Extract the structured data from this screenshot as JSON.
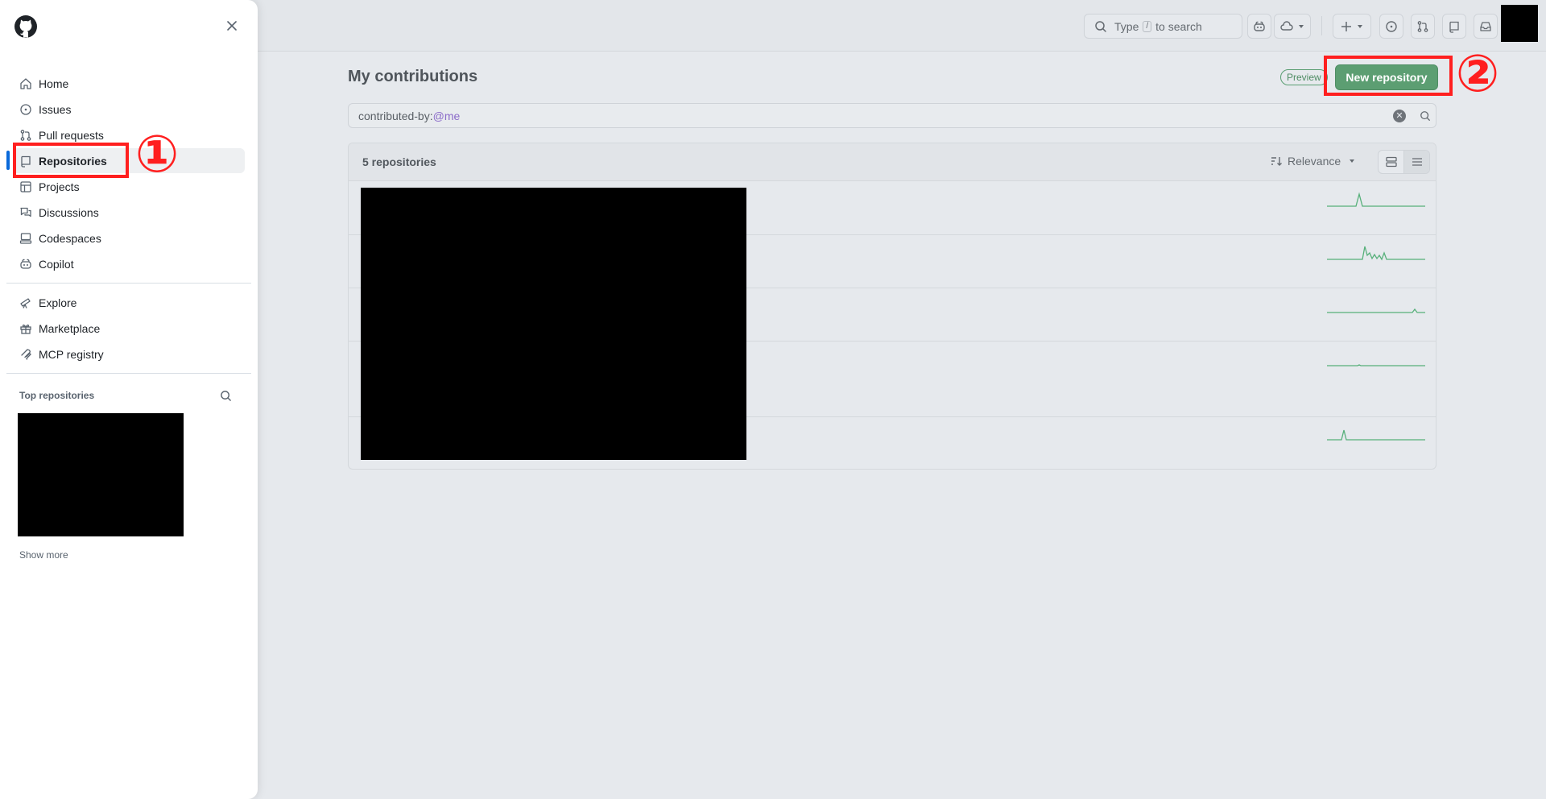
{
  "header": {
    "search_prefix": "Type",
    "search_key": "/",
    "search_suffix": "to search"
  },
  "main": {
    "title": "My contributions",
    "preview_badge": "Preview",
    "new_repo_label": "New repository",
    "filter_prefix": "contributed-by:",
    "filter_value": "@me",
    "repo_count": "5 repositories",
    "sort_label": "Relevance"
  },
  "sidebar": {
    "items": [
      {
        "label": "Home"
      },
      {
        "label": "Issues"
      },
      {
        "label": "Pull requests"
      },
      {
        "label": "Repositories"
      },
      {
        "label": "Projects"
      },
      {
        "label": "Discussions"
      },
      {
        "label": "Codespaces"
      },
      {
        "label": "Copilot"
      }
    ],
    "secondary": [
      {
        "label": "Explore"
      },
      {
        "label": "Marketplace"
      },
      {
        "label": "MCP registry"
      }
    ],
    "top_repos_title": "Top repositories",
    "show_more": "Show more"
  },
  "annotations": {
    "one": "①",
    "two": "②"
  },
  "colors": {
    "accent": "#0969da",
    "primary_button": "#5c9e72",
    "annotation": "#ff1f1f"
  }
}
